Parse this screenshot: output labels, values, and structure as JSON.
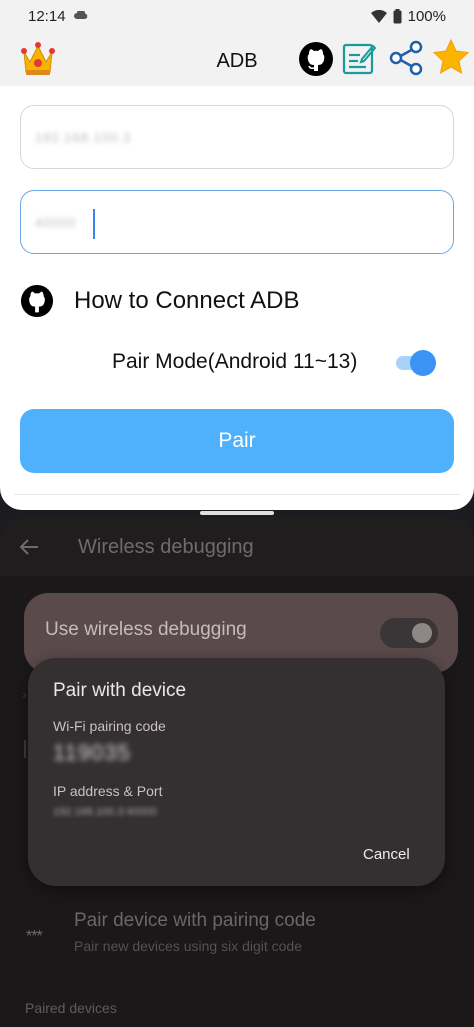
{
  "status": {
    "time": "12:14",
    "battery": "100%"
  },
  "app": {
    "title": "ADB",
    "ip_field_value": "192.168.100.3",
    "port_field_value": "40000",
    "howto_label": "How to Connect ADB",
    "pair_mode_label": "Pair Mode(Android 11~13)",
    "pair_mode_on": true,
    "pair_button": "Pair",
    "icons": [
      "crown-icon",
      "github-icon",
      "note-edit-icon",
      "share-icon",
      "star-icon"
    ],
    "accent": "#4fb0fb"
  },
  "settings": {
    "title": "Wireless debugging",
    "use_wireless": "Use wireless debugging",
    "pair_code_title": "Pair device with pairing code",
    "pair_code_sub": "Pair new devices using six digit code",
    "paired_devices": "Paired devices"
  },
  "dialog": {
    "title": "Pair with device",
    "code_label": "Wi-Fi pairing code",
    "code_value": "119035",
    "ip_label": "IP address & Port",
    "ip_value": "192.168.100.3:40000",
    "cancel": "Cancel"
  }
}
